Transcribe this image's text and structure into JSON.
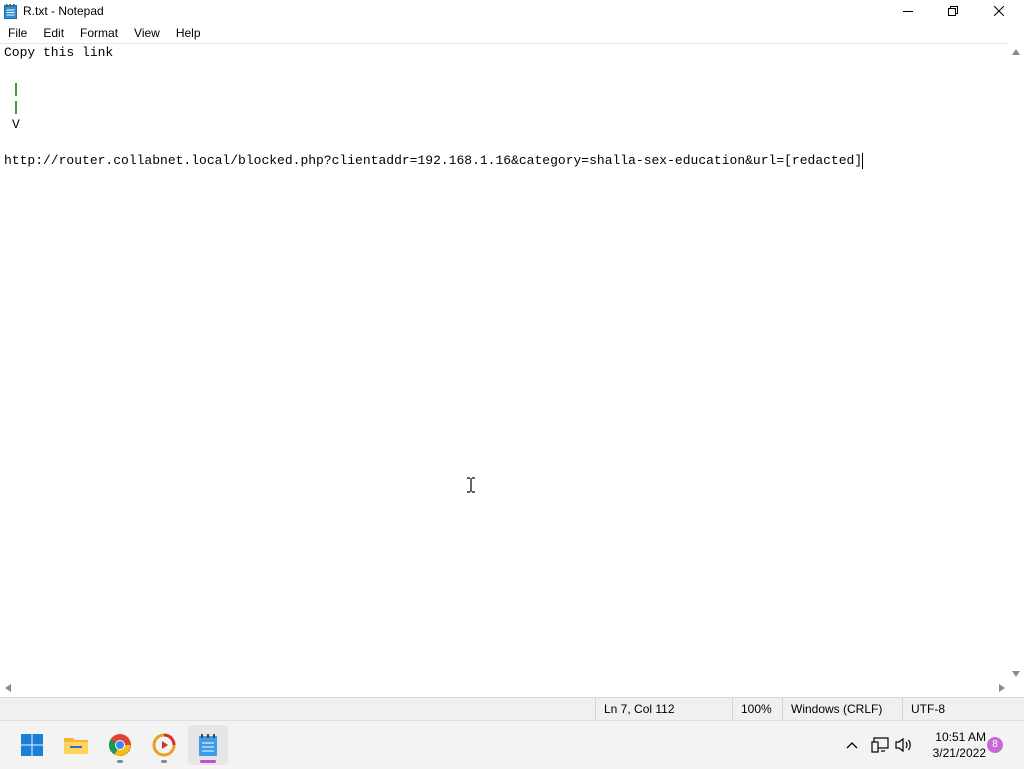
{
  "window": {
    "title": "R.txt - Notepad"
  },
  "menu": [
    "File",
    "Edit",
    "Format",
    "View",
    "Help"
  ],
  "editor": {
    "lines": [
      "Copy this link",
      "",
      "",
      "",
      "V",
      "",
      "http://router.collabnet.local/blocked.php?clientaddr=192.168.1.16&category=shalla-sex-education&url=[redacted]"
    ]
  },
  "status": {
    "position": "Ln 7, Col 112",
    "zoom": "100%",
    "line_endings": "Windows (CRLF)",
    "encoding": "UTF-8"
  },
  "taskbar": {
    "apps": [
      "start-button",
      "file-explorer",
      "chrome",
      "media-player",
      "notepad"
    ],
    "active_app": "notepad"
  },
  "tray": {
    "time": "10:51 AM",
    "date": "3/21/2022",
    "notification_count": "8"
  },
  "icons": {
    "green_marker_color": "#3f9b3f",
    "accent_color": "#c04fd0"
  }
}
